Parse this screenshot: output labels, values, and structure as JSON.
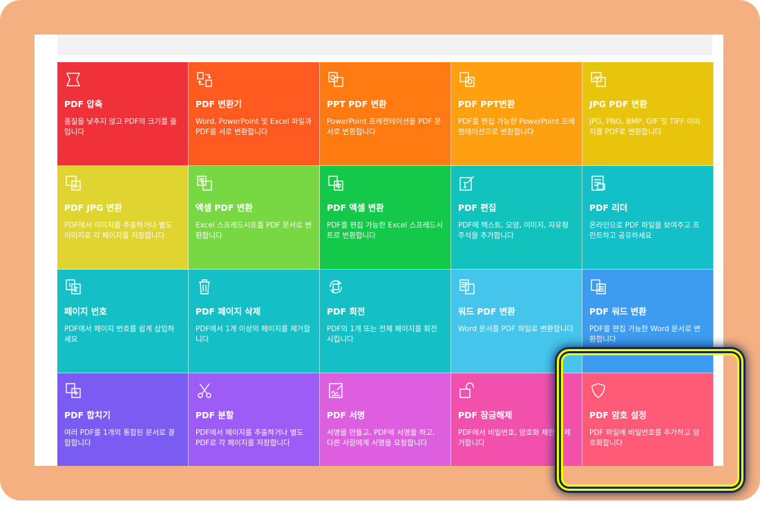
{
  "tiles": [
    {
      "title": "PDF 압축",
      "desc": "품질을 낮추지 않고 PDF의 크기를 줄입니다",
      "color": "#f0313a",
      "icon": "compress-icon"
    },
    {
      "title": "PDF 변환기",
      "desc": "Word, PowerPoint 및 Excel 파일과 PDF를 서로 변환합니다",
      "color": "#ff5a1f",
      "icon": "convert-icon"
    },
    {
      "title": "PPT PDF 변환",
      "desc": "PowerPoint 프레젠테이션을 PDF 문서로 변환합니다",
      "color": "#ff7a10",
      "icon": "ppt-to-pdf-icon"
    },
    {
      "title": "PDF PPT변환",
      "desc": "PDF를 편집 가능한 PowerPoint 프레젠테이션으로 변환합니다",
      "color": "#ffa010",
      "icon": "pdf-to-ppt-icon"
    },
    {
      "title": "JPG PDF 변환",
      "desc": "JPG, PNG, BMP, GIF 및 TIFF 이미지를 PDF로 변환합니다",
      "color": "#e8c40c",
      "icon": "jpg-to-pdf-icon"
    },
    {
      "title": "PDF JPG 변환",
      "desc": "PDF에서 이미지를 추출하거나 별도 이미지로 각 페이지를 저장합니다",
      "color": "#e0d430",
      "icon": "pdf-to-jpg-icon"
    },
    {
      "title": "엑셀 PDF 변환",
      "desc": "Excel 스프레드시트를 PDF 문서로 변환합니다",
      "color": "#78d844",
      "icon": "excel-to-pdf-icon"
    },
    {
      "title": "PDF 엑셀 변환",
      "desc": "PDF를 편집 가능한 Excel 스프레드시트로 변환합니다",
      "color": "#14c94a",
      "icon": "pdf-to-excel-icon"
    },
    {
      "title": "PDF 편집",
      "desc": "PDF에 텍스트, 모양, 이미지, 자유형 주석을 추가합니다",
      "color": "#12c2bc",
      "icon": "edit-icon"
    },
    {
      "title": "PDF 리더",
      "desc": "온라인으로 PDF 파일을 보여주고 프린트하고 공유하세요",
      "color": "#14c0c8",
      "icon": "reader-icon"
    },
    {
      "title": "페이지 번호",
      "desc": "PDF에서 페이지 번호를 쉽게 삽입하세요",
      "color": "#14bfc5",
      "icon": "page-number-icon"
    },
    {
      "title": "PDF 페이지 삭제",
      "desc": "PDF에서 1개 이상의 페이지를 제거합니다",
      "color": "#14bfc5",
      "icon": "trash-icon"
    },
    {
      "title": "PDF 회전",
      "desc": "PDF의 1개 또는 전체 페이지를 회전시킵니다",
      "color": "#14bfc5",
      "icon": "rotate-icon"
    },
    {
      "title": "워드 PDF 변환",
      "desc": "Word 문서를 PDF 파일로 변환합니다",
      "color": "#45c4ec",
      "icon": "word-to-pdf-icon"
    },
    {
      "title": "PDF 워드 변환",
      "desc": "PDF를 편집 가능한 Word 문서로 변환합니다",
      "color": "#3e9cf0",
      "icon": "pdf-to-word-icon"
    },
    {
      "title": "PDF 합치기",
      "desc": "여러 PDF를 1개의 통합된 문서로 결합합니다",
      "color": "#7a5cf2",
      "icon": "merge-icon"
    },
    {
      "title": "PDF 분할",
      "desc": "PDF에서 페이지를 추출하거나 별도 PDF로 각 페이지를 저장합니다",
      "color": "#9d5cf5",
      "icon": "scissors-icon"
    },
    {
      "title": "PDF 서명",
      "desc": "서명을 만들고, PDF에 서명을 하고, 다른 사람에게 서명을 요청합니다",
      "color": "#dd5ede",
      "icon": "sign-icon"
    },
    {
      "title": "PDF 잠금해제",
      "desc": "PDF에서 비밀번호, 암호화 제한을 제거합니다",
      "color": "#f150ac",
      "icon": "unlock-icon"
    },
    {
      "title": "PDF 암호 설정",
      "desc": "PDF 파일에 비밀번호를 추가하고 암호화합니다",
      "color": "#ff5a78",
      "icon": "shield-icon"
    }
  ]
}
